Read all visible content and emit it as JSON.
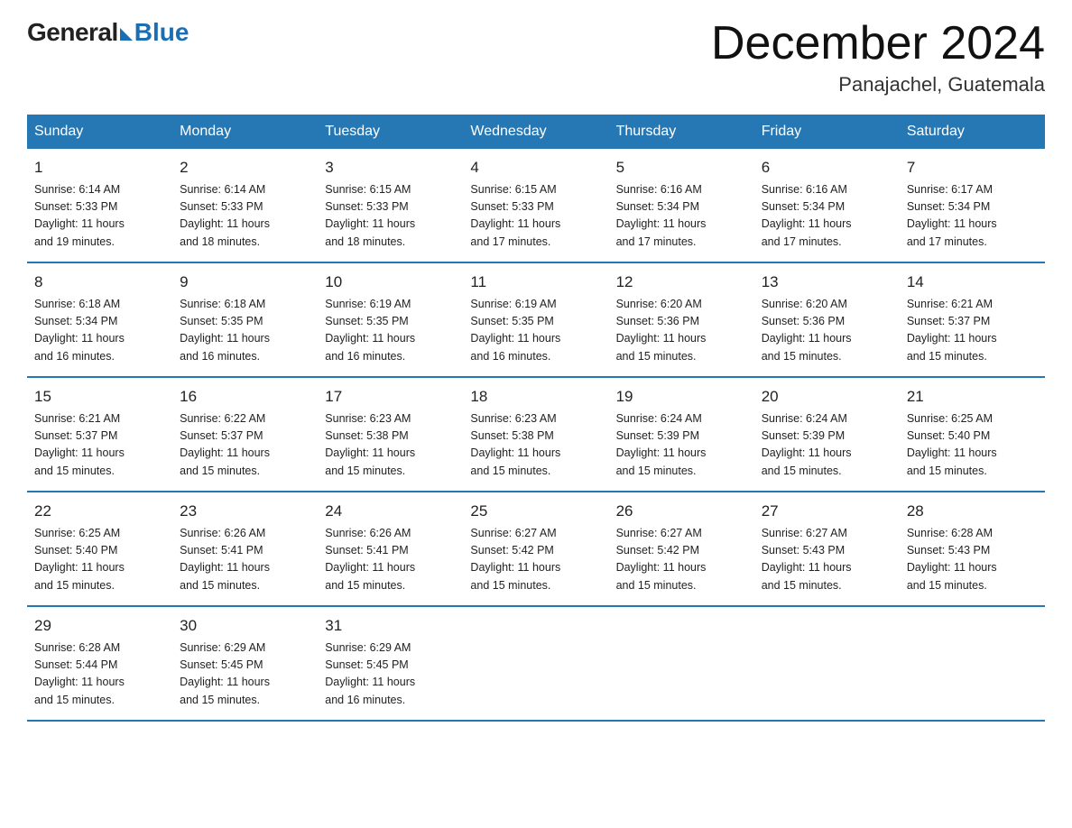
{
  "logo": {
    "general": "General",
    "blue": "Blue",
    "subtitle": ""
  },
  "title": "December 2024",
  "location": "Panajachel, Guatemala",
  "days_of_week": [
    "Sunday",
    "Monday",
    "Tuesday",
    "Wednesday",
    "Thursday",
    "Friday",
    "Saturday"
  ],
  "weeks": [
    [
      {
        "day": "1",
        "sunrise": "6:14 AM",
        "sunset": "5:33 PM",
        "daylight": "11 hours and 19 minutes."
      },
      {
        "day": "2",
        "sunrise": "6:14 AM",
        "sunset": "5:33 PM",
        "daylight": "11 hours and 18 minutes."
      },
      {
        "day": "3",
        "sunrise": "6:15 AM",
        "sunset": "5:33 PM",
        "daylight": "11 hours and 18 minutes."
      },
      {
        "day": "4",
        "sunrise": "6:15 AM",
        "sunset": "5:33 PM",
        "daylight": "11 hours and 17 minutes."
      },
      {
        "day": "5",
        "sunrise": "6:16 AM",
        "sunset": "5:34 PM",
        "daylight": "11 hours and 17 minutes."
      },
      {
        "day": "6",
        "sunrise": "6:16 AM",
        "sunset": "5:34 PM",
        "daylight": "11 hours and 17 minutes."
      },
      {
        "day": "7",
        "sunrise": "6:17 AM",
        "sunset": "5:34 PM",
        "daylight": "11 hours and 17 minutes."
      }
    ],
    [
      {
        "day": "8",
        "sunrise": "6:18 AM",
        "sunset": "5:34 PM",
        "daylight": "11 hours and 16 minutes."
      },
      {
        "day": "9",
        "sunrise": "6:18 AM",
        "sunset": "5:35 PM",
        "daylight": "11 hours and 16 minutes."
      },
      {
        "day": "10",
        "sunrise": "6:19 AM",
        "sunset": "5:35 PM",
        "daylight": "11 hours and 16 minutes."
      },
      {
        "day": "11",
        "sunrise": "6:19 AM",
        "sunset": "5:35 PM",
        "daylight": "11 hours and 16 minutes."
      },
      {
        "day": "12",
        "sunrise": "6:20 AM",
        "sunset": "5:36 PM",
        "daylight": "11 hours and 15 minutes."
      },
      {
        "day": "13",
        "sunrise": "6:20 AM",
        "sunset": "5:36 PM",
        "daylight": "11 hours and 15 minutes."
      },
      {
        "day": "14",
        "sunrise": "6:21 AM",
        "sunset": "5:37 PM",
        "daylight": "11 hours and 15 minutes."
      }
    ],
    [
      {
        "day": "15",
        "sunrise": "6:21 AM",
        "sunset": "5:37 PM",
        "daylight": "11 hours and 15 minutes."
      },
      {
        "day": "16",
        "sunrise": "6:22 AM",
        "sunset": "5:37 PM",
        "daylight": "11 hours and 15 minutes."
      },
      {
        "day": "17",
        "sunrise": "6:23 AM",
        "sunset": "5:38 PM",
        "daylight": "11 hours and 15 minutes."
      },
      {
        "day": "18",
        "sunrise": "6:23 AM",
        "sunset": "5:38 PM",
        "daylight": "11 hours and 15 minutes."
      },
      {
        "day": "19",
        "sunrise": "6:24 AM",
        "sunset": "5:39 PM",
        "daylight": "11 hours and 15 minutes."
      },
      {
        "day": "20",
        "sunrise": "6:24 AM",
        "sunset": "5:39 PM",
        "daylight": "11 hours and 15 minutes."
      },
      {
        "day": "21",
        "sunrise": "6:25 AM",
        "sunset": "5:40 PM",
        "daylight": "11 hours and 15 minutes."
      }
    ],
    [
      {
        "day": "22",
        "sunrise": "6:25 AM",
        "sunset": "5:40 PM",
        "daylight": "11 hours and 15 minutes."
      },
      {
        "day": "23",
        "sunrise": "6:26 AM",
        "sunset": "5:41 PM",
        "daylight": "11 hours and 15 minutes."
      },
      {
        "day": "24",
        "sunrise": "6:26 AM",
        "sunset": "5:41 PM",
        "daylight": "11 hours and 15 minutes."
      },
      {
        "day": "25",
        "sunrise": "6:27 AM",
        "sunset": "5:42 PM",
        "daylight": "11 hours and 15 minutes."
      },
      {
        "day": "26",
        "sunrise": "6:27 AM",
        "sunset": "5:42 PM",
        "daylight": "11 hours and 15 minutes."
      },
      {
        "day": "27",
        "sunrise": "6:27 AM",
        "sunset": "5:43 PM",
        "daylight": "11 hours and 15 minutes."
      },
      {
        "day": "28",
        "sunrise": "6:28 AM",
        "sunset": "5:43 PM",
        "daylight": "11 hours and 15 minutes."
      }
    ],
    [
      {
        "day": "29",
        "sunrise": "6:28 AM",
        "sunset": "5:44 PM",
        "daylight": "11 hours and 15 minutes."
      },
      {
        "day": "30",
        "sunrise": "6:29 AM",
        "sunset": "5:45 PM",
        "daylight": "11 hours and 15 minutes."
      },
      {
        "day": "31",
        "sunrise": "6:29 AM",
        "sunset": "5:45 PM",
        "daylight": "11 hours and 16 minutes."
      },
      {
        "day": "",
        "sunrise": "",
        "sunset": "",
        "daylight": ""
      },
      {
        "day": "",
        "sunrise": "",
        "sunset": "",
        "daylight": ""
      },
      {
        "day": "",
        "sunrise": "",
        "sunset": "",
        "daylight": ""
      },
      {
        "day": "",
        "sunrise": "",
        "sunset": "",
        "daylight": ""
      }
    ]
  ]
}
